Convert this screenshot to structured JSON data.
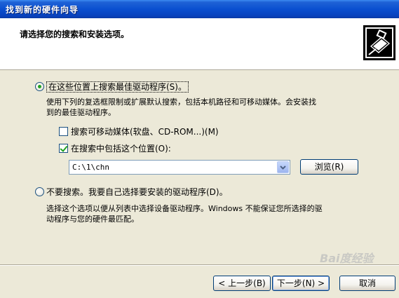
{
  "window": {
    "title": "找到新的硬件向导"
  },
  "header": {
    "heading": "请选择您的搜索和安装选项。",
    "icon": "hardware-wizard-icon"
  },
  "option_search": {
    "label": "在这些位置上搜索最佳驱动程序(S)。",
    "selected": true,
    "description_line1": "使用下列的复选框限制或扩展默认搜索，包括本机路径和可移动媒体。会安装找",
    "description_line2": "到的最佳驱动程序。",
    "checkbox_removable": {
      "label": "搜索可移动媒体(软盘、CD-ROM...)(M)",
      "checked": false
    },
    "checkbox_location": {
      "label": "在搜索中包括这个位置(O):",
      "checked": true
    },
    "path_value": "C:\\1\\chn",
    "browse_label": "浏览(R)"
  },
  "option_manual": {
    "label": "不要搜索。我要自己选择要安装的驱动程序(D)。",
    "selected": false,
    "description_line1": "选择这个选项以便从列表中选择设备驱动程序。Windows 不能保证您所选择的驱",
    "description_line2": "动程序与您的硬件最匹配。"
  },
  "footer": {
    "back_label": "< 上一步(B)",
    "next_label": "下一步(N) >",
    "cancel_label": "取消"
  },
  "watermark": "Bai度经验",
  "colors": {
    "titlebar": "#0a4fd0",
    "dialog_bg": "#ece9d8",
    "header_bg": "#ffffff",
    "check_green": "#21a121"
  }
}
